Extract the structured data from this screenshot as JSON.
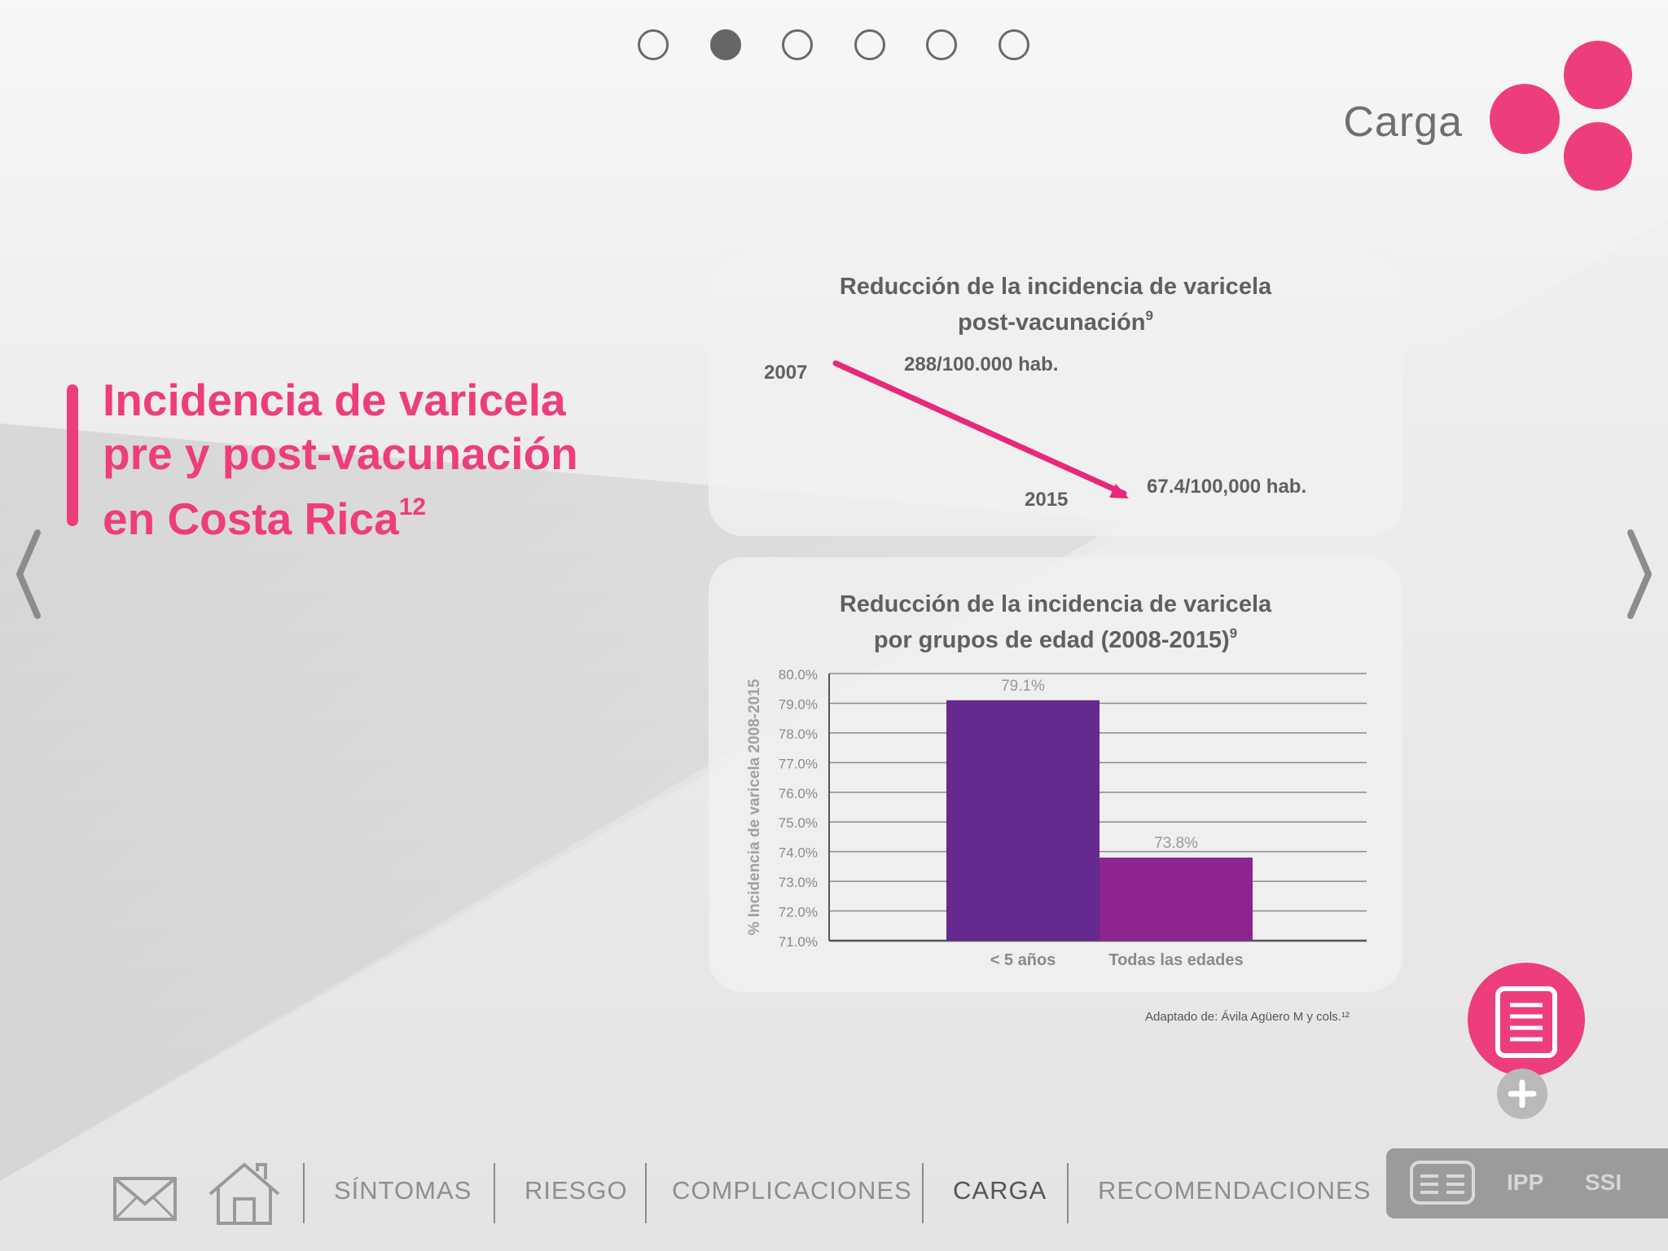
{
  "pagination": {
    "total": 6,
    "active_index": 1
  },
  "header": {
    "section_title": "Carga"
  },
  "headline": {
    "lines": [
      "Incidencia de varicela",
      "pre y post-vacunación",
      "en Costa Rica"
    ],
    "superscript": "12"
  },
  "card1": {
    "title_line1": "Reducción de la incidencia de varicela",
    "title_line2": "post-vacunación",
    "title_sup": "9",
    "year_start": "2007",
    "value_start": "288/100.000 hab.",
    "year_end": "2015",
    "value_end": "67.4/100,000 hab."
  },
  "card2": {
    "title_line1": "Reducción de la incidencia de varicela",
    "title_line2": "por grupos de edad (2008-2015)",
    "title_sup": "9"
  },
  "chart_data": {
    "type": "bar",
    "title": "Reducción de la incidencia de varicela por grupos de edad (2008-2015)",
    "ylabel": "% Incidencia de varicela 2008-2015",
    "categories": [
      "< 5 años",
      "Todas las edades"
    ],
    "values": [
      79.1,
      73.8
    ],
    "data_labels": [
      "79.1%",
      "73.8%"
    ],
    "colors": [
      "#66298f",
      "#8e248f"
    ],
    "ylim": [
      71.0,
      80.0
    ],
    "yticks": [
      "71.0%",
      "72.0%",
      "73.0%",
      "74.0%",
      "75.0%",
      "76.0%",
      "77.0%",
      "78.0%",
      "79.0%",
      "80.0%"
    ],
    "grid": true
  },
  "source_note": "Adaptado de: Ávila Agüero M y cols.¹²",
  "bottom_nav": {
    "items": [
      "SÍNTOMAS",
      "RIESGO",
      "COMPLICACIONES",
      "CARGA",
      "RECOMENDACIONES"
    ],
    "active": "CARGA",
    "icons": [
      "mail-icon",
      "home-icon"
    ]
  },
  "side_panel": {
    "items": [
      "IPP",
      "SSI"
    ],
    "icon": "reference-list-icon"
  },
  "colors": {
    "accent": "#ee3d7c",
    "text_grey": "#606060",
    "bar_primary": "#66298f",
    "bar_secondary": "#8e248f"
  }
}
